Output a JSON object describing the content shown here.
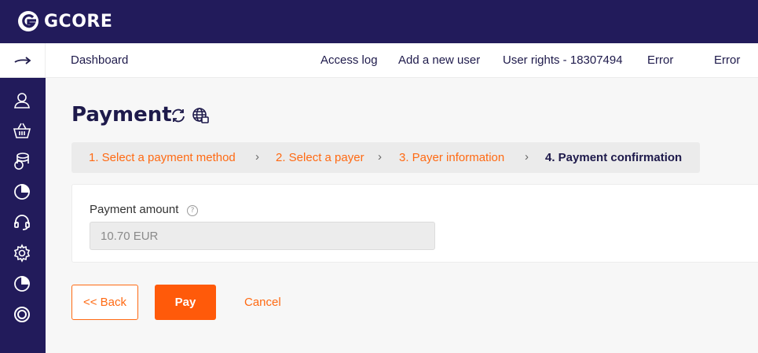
{
  "brand": {
    "name": "GCORE",
    "accent": "#ff6a13",
    "primary": "#221b5b"
  },
  "nav": {
    "collapse_icon": "arrow-right-icon",
    "dashboard": "Dashboard",
    "links": [
      "Access log",
      "Add a new user",
      "User rights - 18307494",
      "Error",
      "Error"
    ]
  },
  "sidebar": {
    "items": [
      "user-icon",
      "basket-icon",
      "coins-icon",
      "pie-chart-icon",
      "headset-icon",
      "gear-icon",
      "pie-chart-icon",
      "lifebuoy-icon"
    ]
  },
  "page": {
    "title": "Payment",
    "title_icons": [
      "refresh-icon",
      "globe-icon"
    ]
  },
  "steps": {
    "items": [
      "1. Select a payment method",
      "2. Select a payer",
      "3. Payer information",
      "4. Payment confirmation"
    ],
    "separator": "›",
    "current_index": 3
  },
  "form": {
    "amount_label": "Payment amount",
    "help": "?",
    "amount_value": "10.70 EUR"
  },
  "actions": {
    "back": "<< Back",
    "pay": "Pay",
    "cancel": "Cancel"
  }
}
